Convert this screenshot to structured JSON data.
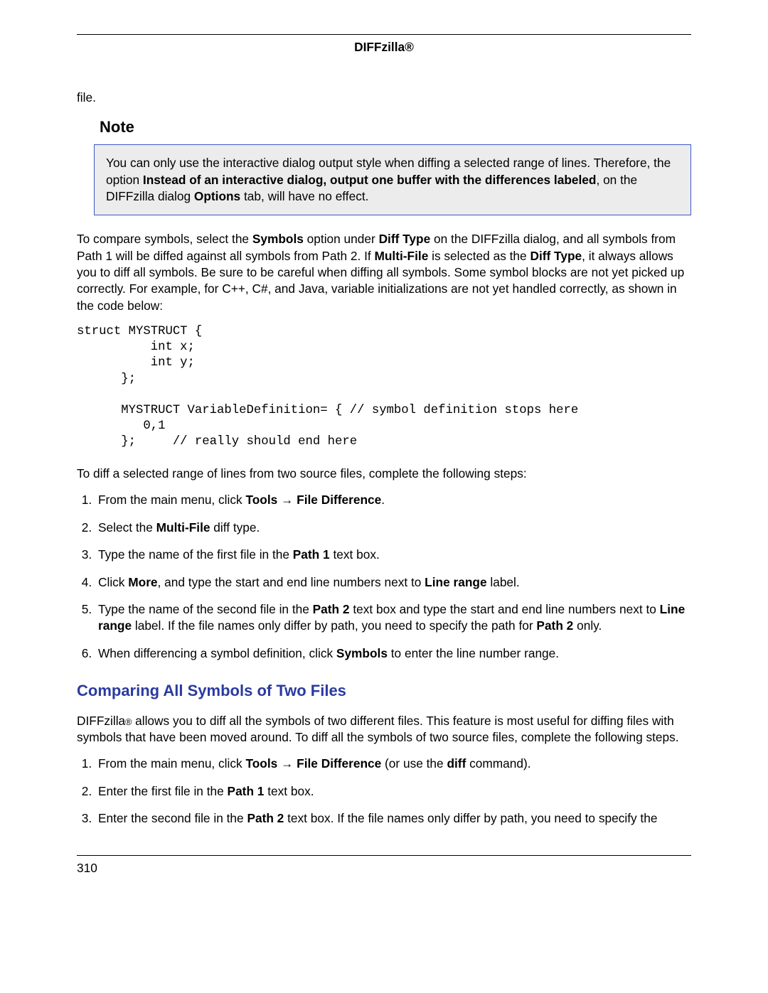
{
  "header": {
    "title": "DIFFzilla®"
  },
  "intro_fragment": "file.",
  "note": {
    "label": "Note",
    "line1_pre": "You can only use the interactive dialog output style when diffing a selected range of lines. Therefore, the option ",
    "line1_bold": "Instead of an interactive dialog, output one buffer with the differences labeled",
    "line1_mid": ", on the DIFFzilla dialog ",
    "line1_bold2": "Options",
    "line1_post": " tab, will have no effect."
  },
  "para_compare": {
    "t1": "To compare symbols, select the ",
    "b1": "Symbols",
    "t2": " option under ",
    "b2": "Diff Type",
    "t3": " on the DIFFzilla dialog, and all symbols from Path 1 will be diffed against all symbols from Path 2. If ",
    "b3": "Multi-File",
    "t4": " is selected as the ",
    "b4": "Diff Type",
    "t5": ", it always allows you to diff all symbols. Be sure to be careful when diffing all symbols. Some symbol blocks are not yet picked up correctly. For example, for C++, C#, and Java, variable initializations are not yet handled correctly, as shown in the code below:"
  },
  "code": "struct MYSTRUCT {\n          int x;\n          int y;\n      };\n\n      MYSTRUCT VariableDefinition= { // symbol definition stops here\n         0,1\n      };     // really should end here",
  "para_diff_range": "To diff a selected range of lines from two source files, complete the following steps:",
  "steps_a": {
    "s1": {
      "t1": "From the main menu, click ",
      "b1": "Tools",
      "arrow": " → ",
      "b2": "File Difference",
      "t2": "."
    },
    "s2": {
      "t1": "Select the ",
      "b1": "Multi-File",
      "t2": " diff type."
    },
    "s3": {
      "t1": "Type the name of the first file in the ",
      "b1": "Path 1",
      "t2": " text box."
    },
    "s4": {
      "t1": "Click ",
      "b1": "More",
      "t2": ", and type the start and end line numbers next to ",
      "b2": "Line range",
      "t3": " label."
    },
    "s5": {
      "t1": "Type the name of the second file in the ",
      "b1": "Path 2",
      "t2": " text box and type the start and end line numbers next to ",
      "b2": "Line range",
      "t3": " label. If the file names only differ by path, you need to specify the path for ",
      "b3": "Path 2",
      "t4": " only."
    },
    "s6": {
      "t1": "When differencing a symbol definition, click ",
      "b1": "Symbols",
      "t2": " to enter the line number range."
    }
  },
  "section2": {
    "heading": "Comparing All Symbols of Two Files",
    "intro_pre": "DIFFzilla",
    "intro_reg": "®",
    "intro_post": " allows you to diff all the symbols of two different files. This feature is most useful for diffing files with symbols that have been moved around. To diff all the symbols of two source files, complete the following steps."
  },
  "steps_b": {
    "s1": {
      "t1": "From the main menu, click ",
      "b1": "Tools",
      "arrow": " → ",
      "b2": "File Difference",
      "t2": " (or use the ",
      "b3": "diff",
      "t3": " command)."
    },
    "s2": {
      "t1": "Enter the first file in the ",
      "b1": "Path 1",
      "t2": " text box."
    },
    "s3": {
      "t1": "Enter the second file in the ",
      "b1": "Path 2",
      "t2": " text box. If the file names only differ by path, you need to specify the"
    }
  },
  "footer": {
    "page_number": "310"
  }
}
